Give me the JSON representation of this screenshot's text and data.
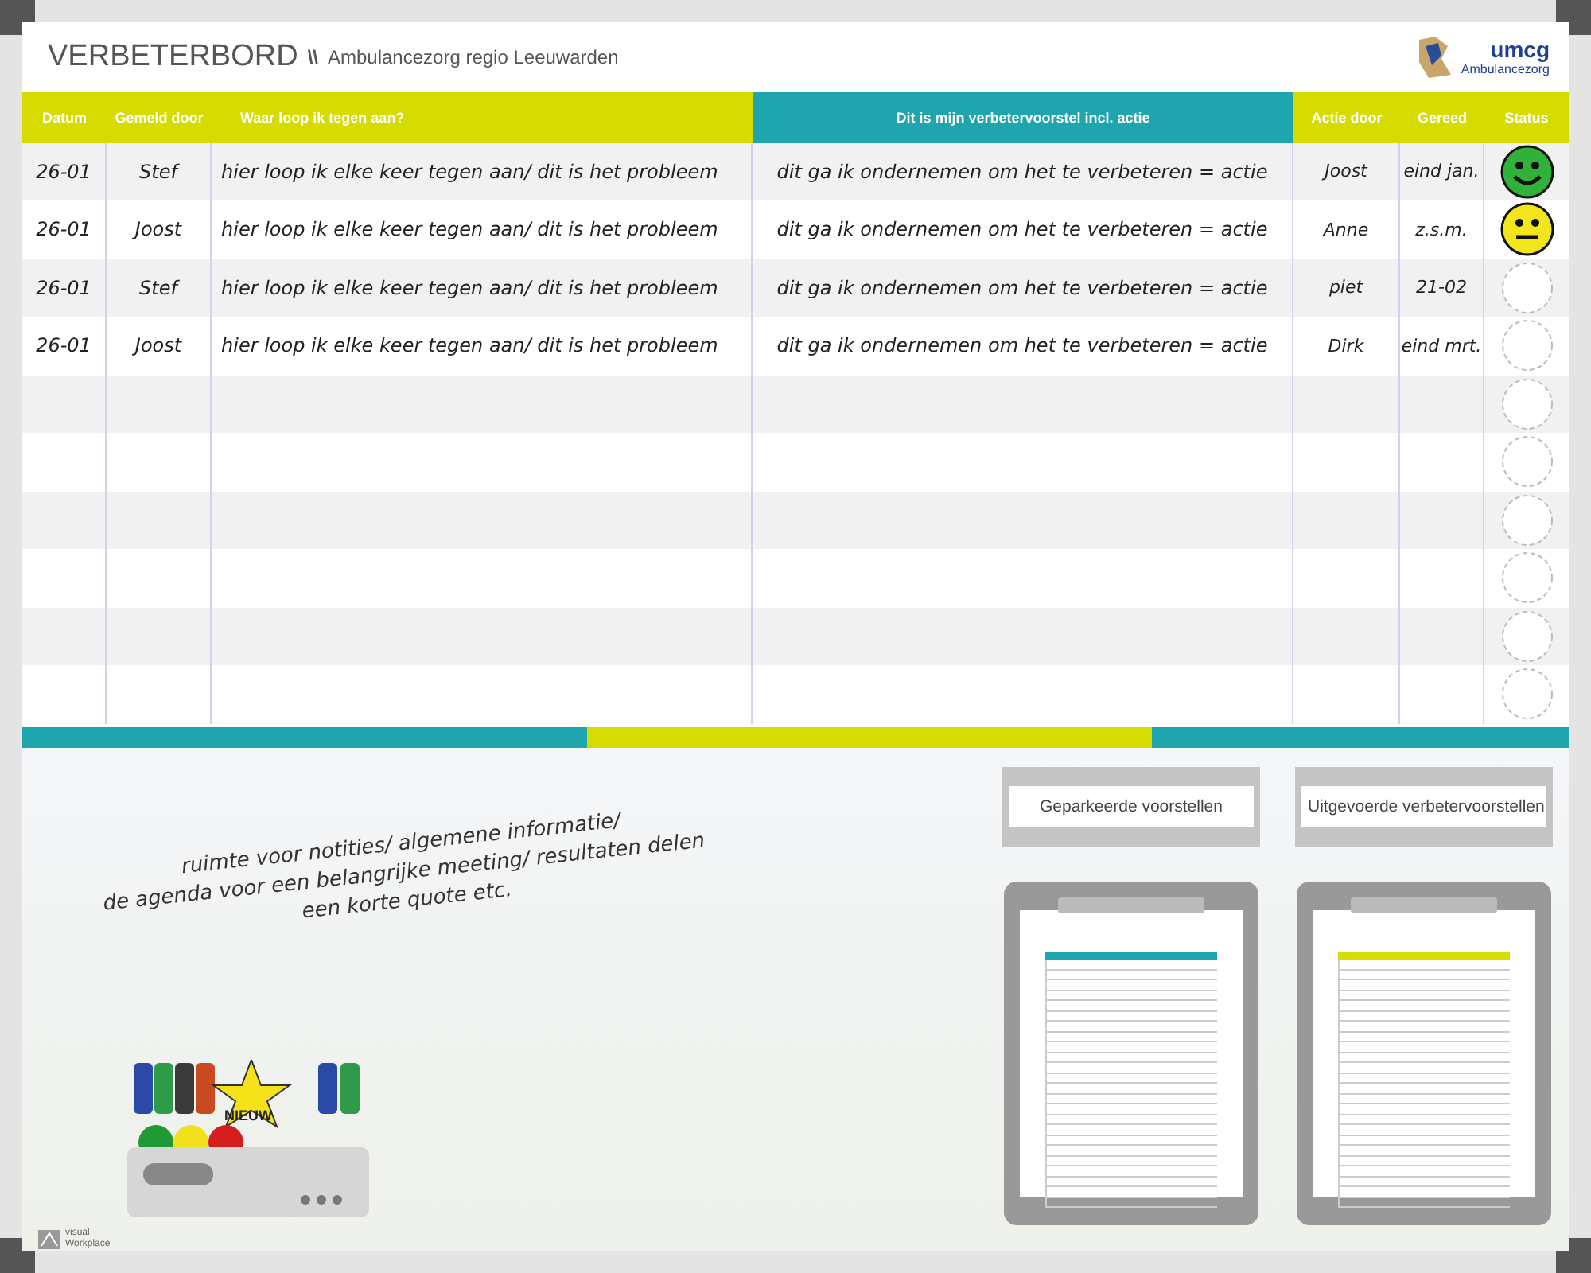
{
  "header": {
    "title": "VERBETERBORD",
    "separator": "\\\\",
    "subtitle": "Ambulancezorg regio Leeuwarden",
    "logo": {
      "name": "umcg",
      "tagline": "Ambulancezorg"
    }
  },
  "table": {
    "columns": [
      {
        "label": "Datum",
        "color": "#d6dc00"
      },
      {
        "label": "Gemeld door",
        "color": "#d6dc00"
      },
      {
        "label": "Waar loop ik tegen aan?",
        "color": "#d6dc00"
      },
      {
        "label": "Dit is mijn verbetervoorstel incl. actie",
        "color": "#1ea5ae"
      },
      {
        "label": "Actie door",
        "color": "#d6dc00"
      },
      {
        "label": "Gereed",
        "color": "#d6dc00"
      },
      {
        "label": "Status",
        "color": "#d6dc00"
      }
    ],
    "rows": [
      {
        "cells": [
          "26-01",
          "Stef",
          "hier loop ik elke keer tegen aan/ dit is het probleem",
          "dit ga ik ondernemen om het te verbeteren = actie",
          "Joost",
          "eind jan."
        ],
        "kind": "happy"
      },
      {
        "cells": [
          "26-01",
          "Joost",
          "hier loop ik elke keer tegen aan/ dit is het probleem",
          "dit ga ik ondernemen om het te verbeteren = actie",
          "Anne",
          "z.s.m."
        ],
        "kind": "neutral"
      },
      {
        "cells": [
          "26-01",
          "Stef",
          "hier loop ik elke keer tegen aan/ dit is het probleem",
          "dit ga ik ondernemen om het te verbeteren = actie",
          "piet",
          "21-02"
        ],
        "kind": "empty"
      },
      {
        "cells": [
          "26-01",
          "Joost",
          "hier loop ik elke keer tegen aan/ dit is het probleem",
          "dit ga ik ondernemen om het te verbeteren = actie",
          "Dirk",
          "eind mrt."
        ],
        "kind": "empty"
      },
      {
        "kind": "empty"
      },
      {
        "kind": "empty"
      },
      {
        "kind": "empty"
      },
      {
        "kind": "empty"
      },
      {
        "kind": "empty"
      },
      {
        "kind": "empty"
      }
    ]
  },
  "notes": [
    "ruimte voor notities/ algemene informatie/",
    "de agenda voor een belangrijke meeting/ resultaten delen",
    "een korte quote etc."
  ],
  "panels": [
    {
      "label": "Geparkeerde voorstellen",
      "color": "#1ea5ae"
    },
    {
      "label": "Uitgevoerde verbetervoorstellen",
      "color": "#d6dc00"
    }
  ],
  "marker_tray": {
    "badge": "NIEUW"
  },
  "brand": [
    "visual",
    "Workplace"
  ]
}
